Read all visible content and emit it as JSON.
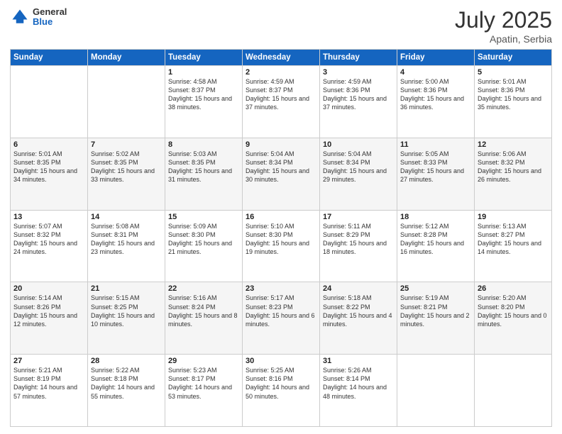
{
  "header": {
    "logo_line1": "General",
    "logo_line2": "Blue",
    "month": "July 2025",
    "location": "Apatin, Serbia"
  },
  "weekdays": [
    "Sunday",
    "Monday",
    "Tuesday",
    "Wednesday",
    "Thursday",
    "Friday",
    "Saturday"
  ],
  "weeks": [
    [
      {
        "day": "",
        "sunrise": "",
        "sunset": "",
        "daylight": ""
      },
      {
        "day": "",
        "sunrise": "",
        "sunset": "",
        "daylight": ""
      },
      {
        "day": "1",
        "sunrise": "Sunrise: 4:58 AM",
        "sunset": "Sunset: 8:37 PM",
        "daylight": "Daylight: 15 hours and 38 minutes."
      },
      {
        "day": "2",
        "sunrise": "Sunrise: 4:59 AM",
        "sunset": "Sunset: 8:37 PM",
        "daylight": "Daylight: 15 hours and 37 minutes."
      },
      {
        "day": "3",
        "sunrise": "Sunrise: 4:59 AM",
        "sunset": "Sunset: 8:36 PM",
        "daylight": "Daylight: 15 hours and 37 minutes."
      },
      {
        "day": "4",
        "sunrise": "Sunrise: 5:00 AM",
        "sunset": "Sunset: 8:36 PM",
        "daylight": "Daylight: 15 hours and 36 minutes."
      },
      {
        "day": "5",
        "sunrise": "Sunrise: 5:01 AM",
        "sunset": "Sunset: 8:36 PM",
        "daylight": "Daylight: 15 hours and 35 minutes."
      }
    ],
    [
      {
        "day": "6",
        "sunrise": "Sunrise: 5:01 AM",
        "sunset": "Sunset: 8:35 PM",
        "daylight": "Daylight: 15 hours and 34 minutes."
      },
      {
        "day": "7",
        "sunrise": "Sunrise: 5:02 AM",
        "sunset": "Sunset: 8:35 PM",
        "daylight": "Daylight: 15 hours and 33 minutes."
      },
      {
        "day": "8",
        "sunrise": "Sunrise: 5:03 AM",
        "sunset": "Sunset: 8:35 PM",
        "daylight": "Daylight: 15 hours and 31 minutes."
      },
      {
        "day": "9",
        "sunrise": "Sunrise: 5:04 AM",
        "sunset": "Sunset: 8:34 PM",
        "daylight": "Daylight: 15 hours and 30 minutes."
      },
      {
        "day": "10",
        "sunrise": "Sunrise: 5:04 AM",
        "sunset": "Sunset: 8:34 PM",
        "daylight": "Daylight: 15 hours and 29 minutes."
      },
      {
        "day": "11",
        "sunrise": "Sunrise: 5:05 AM",
        "sunset": "Sunset: 8:33 PM",
        "daylight": "Daylight: 15 hours and 27 minutes."
      },
      {
        "day": "12",
        "sunrise": "Sunrise: 5:06 AM",
        "sunset": "Sunset: 8:32 PM",
        "daylight": "Daylight: 15 hours and 26 minutes."
      }
    ],
    [
      {
        "day": "13",
        "sunrise": "Sunrise: 5:07 AM",
        "sunset": "Sunset: 8:32 PM",
        "daylight": "Daylight: 15 hours and 24 minutes."
      },
      {
        "day": "14",
        "sunrise": "Sunrise: 5:08 AM",
        "sunset": "Sunset: 8:31 PM",
        "daylight": "Daylight: 15 hours and 23 minutes."
      },
      {
        "day": "15",
        "sunrise": "Sunrise: 5:09 AM",
        "sunset": "Sunset: 8:30 PM",
        "daylight": "Daylight: 15 hours and 21 minutes."
      },
      {
        "day": "16",
        "sunrise": "Sunrise: 5:10 AM",
        "sunset": "Sunset: 8:30 PM",
        "daylight": "Daylight: 15 hours and 19 minutes."
      },
      {
        "day": "17",
        "sunrise": "Sunrise: 5:11 AM",
        "sunset": "Sunset: 8:29 PM",
        "daylight": "Daylight: 15 hours and 18 minutes."
      },
      {
        "day": "18",
        "sunrise": "Sunrise: 5:12 AM",
        "sunset": "Sunset: 8:28 PM",
        "daylight": "Daylight: 15 hours and 16 minutes."
      },
      {
        "day": "19",
        "sunrise": "Sunrise: 5:13 AM",
        "sunset": "Sunset: 8:27 PM",
        "daylight": "Daylight: 15 hours and 14 minutes."
      }
    ],
    [
      {
        "day": "20",
        "sunrise": "Sunrise: 5:14 AM",
        "sunset": "Sunset: 8:26 PM",
        "daylight": "Daylight: 15 hours and 12 minutes."
      },
      {
        "day": "21",
        "sunrise": "Sunrise: 5:15 AM",
        "sunset": "Sunset: 8:25 PM",
        "daylight": "Daylight: 15 hours and 10 minutes."
      },
      {
        "day": "22",
        "sunrise": "Sunrise: 5:16 AM",
        "sunset": "Sunset: 8:24 PM",
        "daylight": "Daylight: 15 hours and 8 minutes."
      },
      {
        "day": "23",
        "sunrise": "Sunrise: 5:17 AM",
        "sunset": "Sunset: 8:23 PM",
        "daylight": "Daylight: 15 hours and 6 minutes."
      },
      {
        "day": "24",
        "sunrise": "Sunrise: 5:18 AM",
        "sunset": "Sunset: 8:22 PM",
        "daylight": "Daylight: 15 hours and 4 minutes."
      },
      {
        "day": "25",
        "sunrise": "Sunrise: 5:19 AM",
        "sunset": "Sunset: 8:21 PM",
        "daylight": "Daylight: 15 hours and 2 minutes."
      },
      {
        "day": "26",
        "sunrise": "Sunrise: 5:20 AM",
        "sunset": "Sunset: 8:20 PM",
        "daylight": "Daylight: 15 hours and 0 minutes."
      }
    ],
    [
      {
        "day": "27",
        "sunrise": "Sunrise: 5:21 AM",
        "sunset": "Sunset: 8:19 PM",
        "daylight": "Daylight: 14 hours and 57 minutes."
      },
      {
        "day": "28",
        "sunrise": "Sunrise: 5:22 AM",
        "sunset": "Sunset: 8:18 PM",
        "daylight": "Daylight: 14 hours and 55 minutes."
      },
      {
        "day": "29",
        "sunrise": "Sunrise: 5:23 AM",
        "sunset": "Sunset: 8:17 PM",
        "daylight": "Daylight: 14 hours and 53 minutes."
      },
      {
        "day": "30",
        "sunrise": "Sunrise: 5:25 AM",
        "sunset": "Sunset: 8:16 PM",
        "daylight": "Daylight: 14 hours and 50 minutes."
      },
      {
        "day": "31",
        "sunrise": "Sunrise: 5:26 AM",
        "sunset": "Sunset: 8:14 PM",
        "daylight": "Daylight: 14 hours and 48 minutes."
      },
      {
        "day": "",
        "sunrise": "",
        "sunset": "",
        "daylight": ""
      },
      {
        "day": "",
        "sunrise": "",
        "sunset": "",
        "daylight": ""
      }
    ]
  ]
}
